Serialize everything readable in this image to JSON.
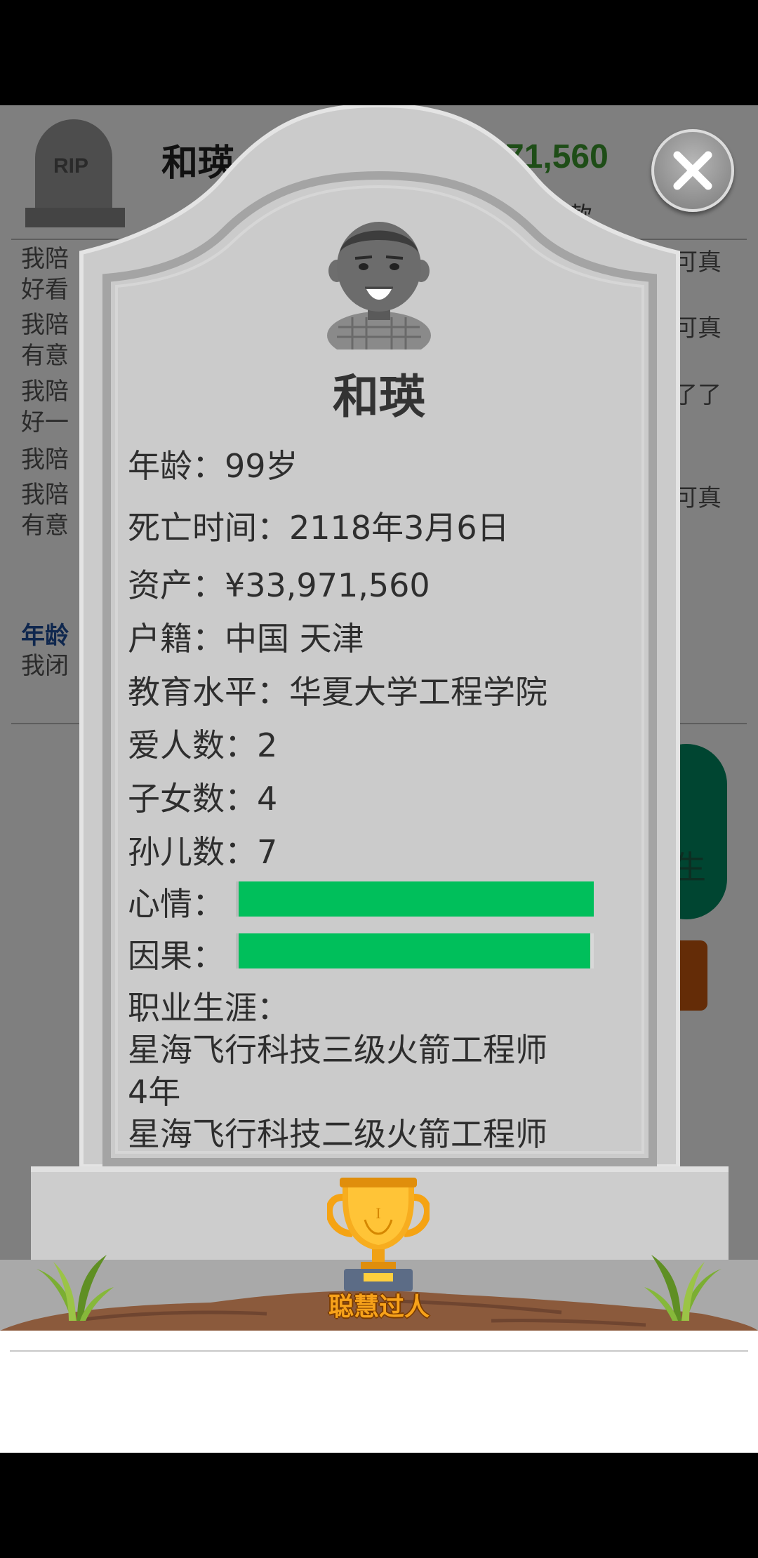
{
  "background": {
    "rip_text": "RIP",
    "name_partial": "和瑛",
    "money_partial": "71,560",
    "money_suffix_partial": "款",
    "log_lines_left": [
      "我陪",
      "好看",
      "我陪",
      "有意",
      "我陪",
      "好一",
      "我陪",
      "我陪",
      "有意"
    ],
    "log_lines_right": [
      "可真",
      "可真",
      "了了",
      "可真"
    ],
    "age_partial": "年龄",
    "closed_partial": "我闭",
    "green_button_partial": "生"
  },
  "card": {
    "name": "和瑛",
    "age_line": "年龄：99岁",
    "death_time_line": "死亡时间：2118年3月6日",
    "assets_line": "资产：¥33,971,560",
    "hukou_line": "户籍：中国 天津",
    "education_line": "教育水平：华夏大学工程学院",
    "lovers_line": "爱人数：2",
    "children_line": "子女数：4",
    "grandchildren_line": "孙儿数：7",
    "mood_label": "心情：",
    "mood_level": 1.0,
    "karma_label": "因果：",
    "karma_level": 0.99,
    "career_label": "职业生涯：",
    "career_lines": [
      "星海飞行科技三级火箭工程师",
      "4年",
      "星海飞行科技二级火箭工程师"
    ]
  },
  "achievement": {
    "label": "聪慧过人",
    "icon": "trophy-icon"
  },
  "colors": {
    "bar_fill": "#00bf5b",
    "stone": "#cbcbcb",
    "label_orange": "#f7a21a"
  }
}
